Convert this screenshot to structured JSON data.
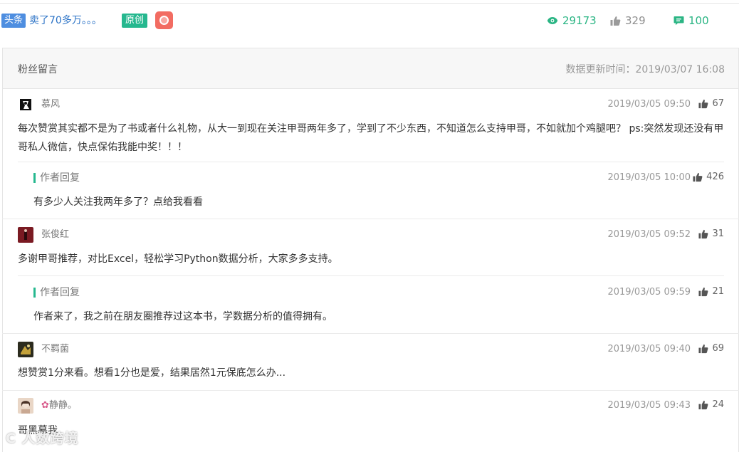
{
  "article": {
    "tag_toutiao": "头条",
    "title": "卖了70多万。。。",
    "tag_original": "原创",
    "views": "29173",
    "likes": "329",
    "comments": "100"
  },
  "panel": {
    "title": "粉丝留言",
    "update_time": "数据更新时间：2019/03/07 16:08"
  },
  "comments": [
    {
      "user": "慕风",
      "time": "2019/03/05 09:50",
      "likes": "67",
      "text": "每次赞赏其实都不是为了书或者什么礼物，从大一到现在关注甲哥两年多了，学到了不少东西，不知道怎么支持甲哥，不如就加个鸡腿吧？ ps:突然发现还没有甲哥私人微信，快点保佑我能中奖！！！",
      "reply": {
        "label": "作者回复",
        "time": "2019/03/05 10:00",
        "likes": "426",
        "text": "有多少人关注我两年多了？点给我看看"
      }
    },
    {
      "user": "张俊红",
      "time": "2019/03/05 09:52",
      "likes": "31",
      "text": "多谢甲哥推荐，对比Excel，轻松学习Python数据分析，大家多多支持。",
      "reply": {
        "label": "作者回复",
        "time": "2019/03/05 09:59",
        "likes": "21",
        "text": "作者来了，我之前在朋友圈推荐过这本书，学数据分析的值得拥有。"
      }
    },
    {
      "user": "不羁菌",
      "time": "2019/03/05 09:40",
      "likes": "69",
      "text": "想赞赏1分来看。想看1分也是爱，结果居然1元保底怎么办..."
    },
    {
      "user": "静静。",
      "time": "2019/03/05 09:43",
      "likes": "24",
      "text": "哥黑幕我"
    }
  ],
  "watermark": "C 人数跨境",
  "colors": {
    "accent_green": "#26b88f",
    "toutiao_blue": "#4e8ee0",
    "title_blue": "#2a72c6",
    "reward_red": "#f26c62"
  },
  "icons": {
    "views": "eye-icon",
    "likes": "thumbs-up-icon",
    "comments": "comment-bubble-icon",
    "reward": "reward-badge-icon"
  }
}
